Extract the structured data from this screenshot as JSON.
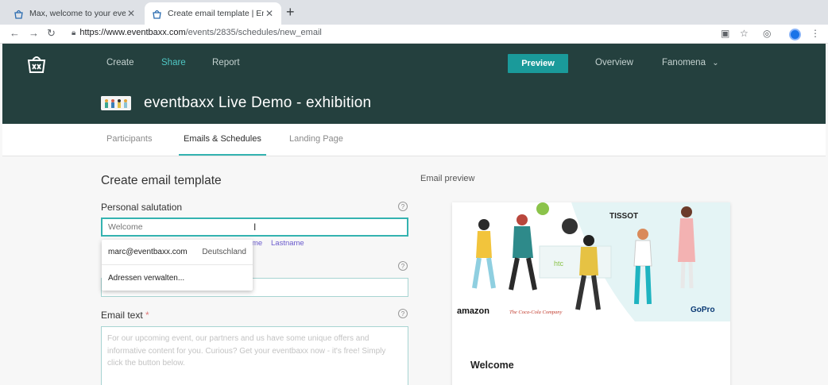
{
  "browser": {
    "tabs": [
      {
        "title": "Max, welcome to your eventba",
        "active": false
      },
      {
        "title": "Create email template | Emails",
        "active": true
      }
    ],
    "url_host": "https://www.eventbaxx.com",
    "url_path": "/events/2835/schedules/new_email"
  },
  "header": {
    "nav": [
      "Create",
      "Share",
      "Report"
    ],
    "active_nav": "Share",
    "preview_label": "Preview",
    "overview_label": "Overview",
    "account_label": "Fanomena",
    "event_title": "eventbaxx Live Demo - exhibition",
    "brand_color": "#24403e",
    "accent_color": "#1a9a9a"
  },
  "subnav": {
    "tabs": [
      "Participants",
      "Emails & Schedules",
      "Landing Page"
    ],
    "active": "Emails & Schedules"
  },
  "form": {
    "heading": "Create email template",
    "salutation_label": "Personal salutation",
    "salutation_placeholder": "Welcome",
    "tag_partial": "me",
    "tag_lastname": "Lastname",
    "email_text_label": "Email text",
    "required_mark": "*",
    "email_text_placeholder": "For our upcoming event, our partners and us have some unique offers and informative content for you. Curious? Get your eventbaxx now - it's free! Simply click the button below."
  },
  "autocomplete": {
    "email": "marc@eventbaxx.com",
    "country": "Deutschland",
    "manage_label": "Adressen verwalten..."
  },
  "preview": {
    "heading": "Email preview",
    "welcome": "Welcome",
    "logos": [
      "TISSOT",
      "htc",
      "amazon",
      "The Coca-Cola Company",
      "GoPro"
    ]
  }
}
